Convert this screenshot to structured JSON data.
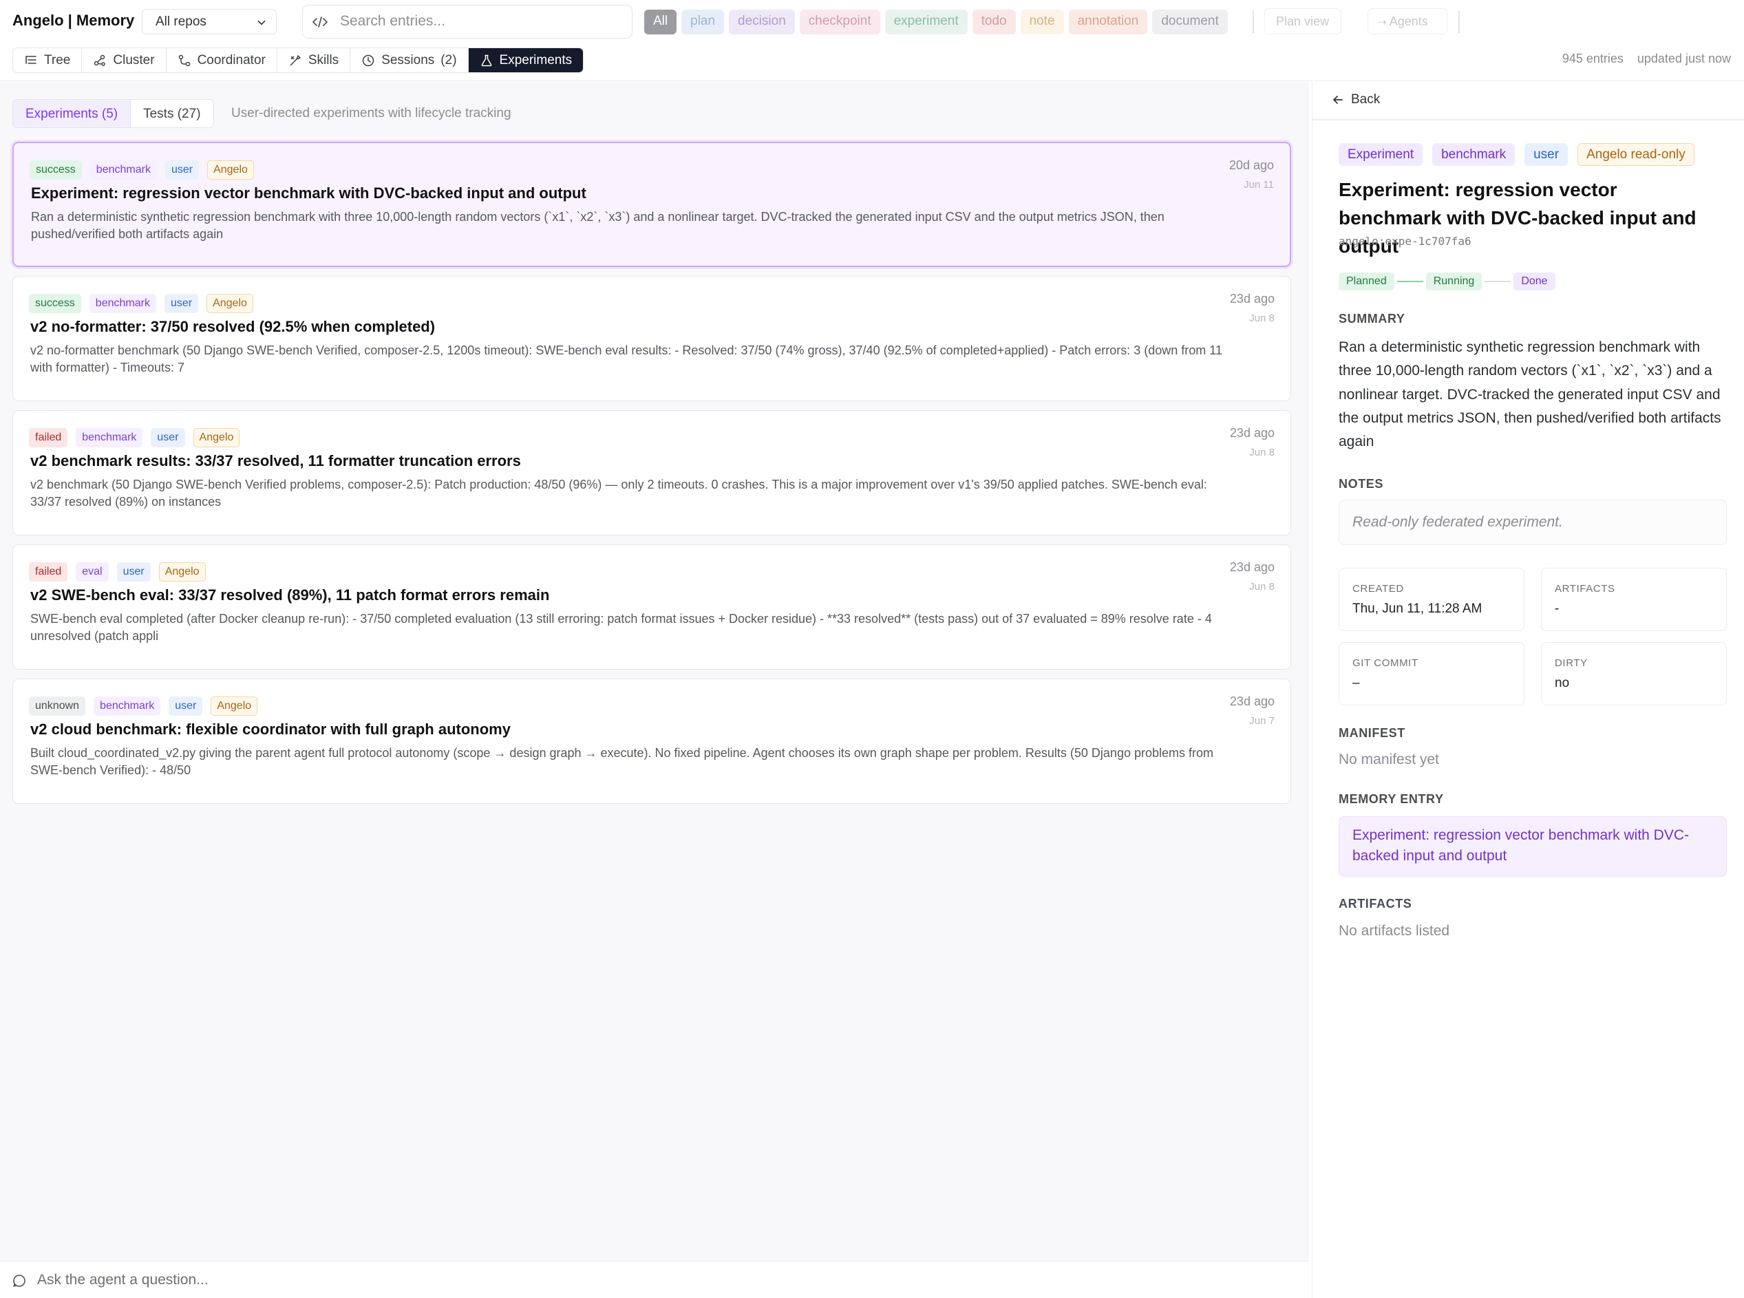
{
  "header": {
    "brand": "Angelo | Memory",
    "repo_select": "All repos",
    "search_placeholder": "Search entries...",
    "filter_chips": [
      {
        "label": "All",
        "active": true
      },
      {
        "label": "plan"
      },
      {
        "label": "decision"
      },
      {
        "label": "checkpoint"
      },
      {
        "label": "experiment"
      },
      {
        "label": "todo"
      },
      {
        "label": "note"
      },
      {
        "label": "annotation"
      },
      {
        "label": "document"
      }
    ],
    "plan_view": "Plan view",
    "agents": "Agents",
    "view_tabs": [
      {
        "label": "Tree",
        "icon": "tree-icon"
      },
      {
        "label": "Cluster",
        "icon": "cluster-icon"
      },
      {
        "label": "Coordinator",
        "icon": "coordinator-icon"
      },
      {
        "label": "Skills",
        "icon": "skills-icon"
      },
      {
        "label": "Sessions",
        "count": "(2)",
        "icon": "clock-icon"
      },
      {
        "label": "Experiments",
        "icon": "flask-icon",
        "active": true
      }
    ],
    "entries_count": "945 entries",
    "updated": "updated just now"
  },
  "left": {
    "subtabs": [
      {
        "label": "Experiments (5)",
        "active": true
      },
      {
        "label": "Tests (27)"
      }
    ],
    "subtitle": "User-directed experiments with lifecycle tracking",
    "cards": [
      {
        "tags": [
          "success",
          "benchmark",
          "user",
          "Angelo"
        ],
        "title": "Experiment: regression vector benchmark with DVC-backed input and output",
        "desc": "Ran a deterministic synthetic regression benchmark with three 10,000-length random vectors (`x1`, `x2`, `x3`) and a nonlinear target. DVC-tracked the generated input CSV and the output metrics JSON, then pushed/verified both artifacts again",
        "ago": "20d ago",
        "date": "Jun 11",
        "selected": true
      },
      {
        "tags": [
          "success",
          "benchmark",
          "user",
          "Angelo"
        ],
        "title": "v2 no-formatter: 37/50 resolved (92.5% when completed)",
        "desc": "v2 no-formatter benchmark (50 Django SWE-bench Verified, composer-2.5, 1200s timeout): SWE-bench eval results: - Resolved: 37/50 (74% gross), 37/40 (92.5% of completed+applied) - Patch errors: 3 (down from 11 with formatter) - Timeouts: 7",
        "ago": "23d ago",
        "date": "Jun 8"
      },
      {
        "tags": [
          "failed",
          "benchmark",
          "user",
          "Angelo"
        ],
        "title": "v2 benchmark results: 33/37 resolved, 11 formatter truncation errors",
        "desc": "v2 benchmark (50 Django SWE-bench Verified problems, composer-2.5): Patch production: 48/50 (96%) — only 2 timeouts. 0 crashes. This is a major improvement over v1's 39/50 applied patches. SWE-bench eval: 33/37 resolved (89%) on instances",
        "ago": "23d ago",
        "date": "Jun 8"
      },
      {
        "tags": [
          "failed",
          "eval",
          "user",
          "Angelo"
        ],
        "title": "v2 SWE-bench eval: 33/37 resolved (89%), 11 patch format errors remain",
        "desc": "SWE-bench eval completed (after Docker cleanup re-run): - 37/50 completed evaluation (13 still erroring: patch format issues + Docker residue) - **33 resolved** (tests pass) out of 37 evaluated = 89% resolve rate - 4 unresolved (patch appli",
        "ago": "23d ago",
        "date": "Jun 8"
      },
      {
        "tags": [
          "unknown",
          "benchmark",
          "user",
          "Angelo"
        ],
        "title": "v2 cloud benchmark: flexible coordinator with full graph autonomy",
        "desc": "Built cloud_coordinated_v2.py giving the parent agent full protocol autonomy (scope → design graph → execute). No fixed pipeline. Agent chooses its own graph shape per problem. Results (50 Django problems from SWE-bench Verified): - 48/50",
        "ago": "23d ago",
        "date": "Jun 7"
      }
    ],
    "ask_placeholder": "Ask the agent a question..."
  },
  "detail": {
    "back": "Back",
    "tags": [
      "Experiment",
      "benchmark",
      "user",
      "Angelo read-only"
    ],
    "title": "Experiment: regression vector benchmark with DVC-backed input and output",
    "id": "angelo:expe-1c707fa6",
    "lifecycle": [
      "Planned",
      "Running",
      "Done"
    ],
    "summary_label": "SUMMARY",
    "summary": "Ran a deterministic synthetic regression benchmark with three 10,000-length random vectors (`x1`, `x2`, `x3`) and a nonlinear target. DVC-tracked the generated input CSV and the output metrics JSON, then pushed/verified both artifacts again",
    "notes_label": "NOTES",
    "notes": "Read-only federated experiment.",
    "created_label": "CREATED",
    "created": "Thu, Jun 11, 11:28 AM",
    "artifacts_label": "ARTIFACTS",
    "artifacts": "-",
    "git_label": "GIT COMMIT",
    "git": "–",
    "dirty_label": "DIRTY",
    "dirty": "no",
    "manifest_label": "MANIFEST",
    "manifest": "No manifest yet",
    "memory_label": "MEMORY ENTRY",
    "memory_link": "Experiment: regression vector benchmark with DVC-backed input and output",
    "artifacts_section_label": "ARTIFACTS",
    "artifacts_empty": "No artifacts listed"
  }
}
